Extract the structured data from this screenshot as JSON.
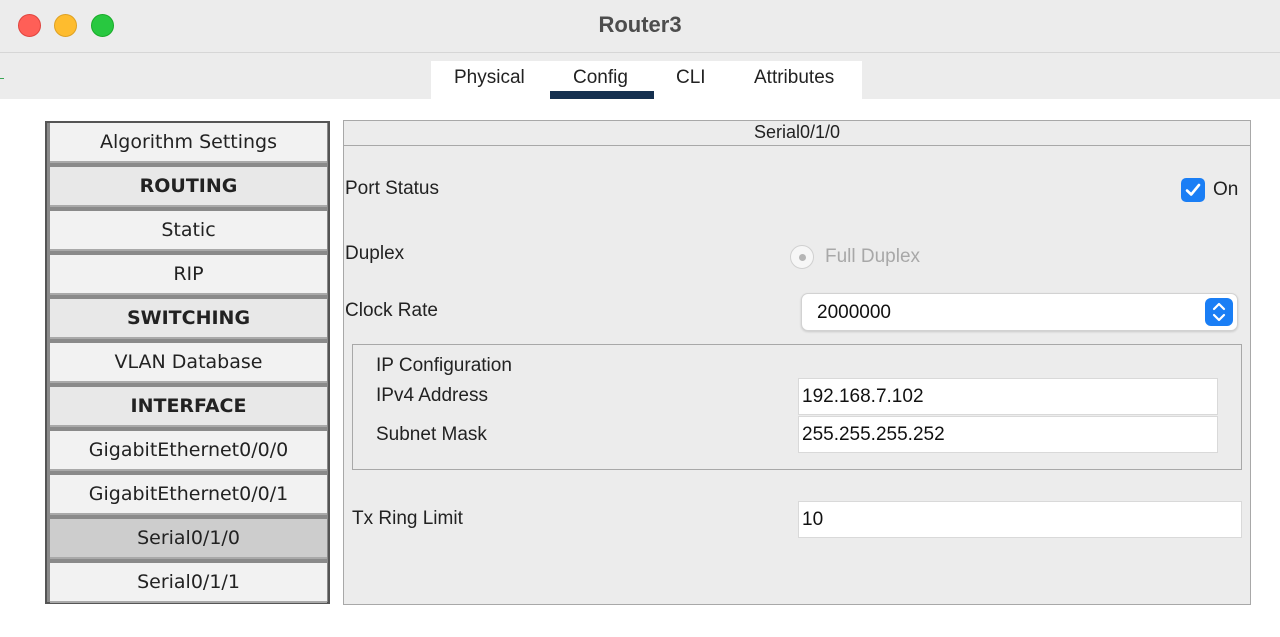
{
  "window": {
    "title": "Router3"
  },
  "tabs": [
    {
      "label": "Physical"
    },
    {
      "label": "Config"
    },
    {
      "label": "CLI"
    },
    {
      "label": "Attributes"
    }
  ],
  "active_tab": "Config",
  "sidebar": {
    "items": [
      {
        "label": "Algorithm Settings"
      },
      {
        "label": "ROUTING"
      },
      {
        "label": "Static"
      },
      {
        "label": "RIP"
      },
      {
        "label": "SWITCHING"
      },
      {
        "label": "VLAN Database"
      },
      {
        "label": "INTERFACE"
      },
      {
        "label": "GigabitEthernet0/0/0"
      },
      {
        "label": "GigabitEthernet0/0/1"
      },
      {
        "label": "Serial0/1/0"
      },
      {
        "label": "Serial0/1/1"
      }
    ],
    "selected": "Serial0/1/0"
  },
  "panel": {
    "title": "Serial0/1/0",
    "port_status": {
      "label": "Port Status",
      "checkbox_label": "On",
      "checked": true
    },
    "duplex": {
      "label": "Duplex",
      "option": "Full Duplex"
    },
    "clock_rate": {
      "label": "Clock Rate",
      "value": "2000000"
    },
    "ip_config": {
      "title": "IP Configuration",
      "ipv4_label": "IPv4 Address",
      "ipv4_value": "192.168.7.102",
      "mask_label": "Subnet Mask",
      "mask_value": "255.255.255.252"
    },
    "tx_ring": {
      "label": "Tx Ring Limit",
      "value": "10"
    }
  },
  "colors": {
    "accent": "#1a7ef5",
    "tab_underline": "#15304f"
  },
  "icons": {
    "checkbox": "checkmark-icon",
    "select": "up-down-chevron-icon"
  }
}
